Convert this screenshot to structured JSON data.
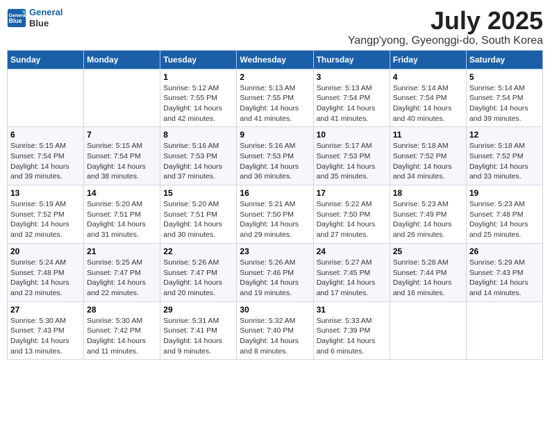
{
  "logo": {
    "line1": "General",
    "line2": "Blue"
  },
  "title": "July 2025",
  "subtitle": "Yangp'yong, Gyeonggi-do, South Korea",
  "headers": [
    "Sunday",
    "Monday",
    "Tuesday",
    "Wednesday",
    "Thursday",
    "Friday",
    "Saturday"
  ],
  "weeks": [
    [
      {
        "day": "",
        "info": ""
      },
      {
        "day": "",
        "info": ""
      },
      {
        "day": "1",
        "info": "Sunrise: 5:12 AM\nSunset: 7:55 PM\nDaylight: 14 hours and 42 minutes."
      },
      {
        "day": "2",
        "info": "Sunrise: 5:13 AM\nSunset: 7:55 PM\nDaylight: 14 hours and 41 minutes."
      },
      {
        "day": "3",
        "info": "Sunrise: 5:13 AM\nSunset: 7:54 PM\nDaylight: 14 hours and 41 minutes."
      },
      {
        "day": "4",
        "info": "Sunrise: 5:14 AM\nSunset: 7:54 PM\nDaylight: 14 hours and 40 minutes."
      },
      {
        "day": "5",
        "info": "Sunrise: 5:14 AM\nSunset: 7:54 PM\nDaylight: 14 hours and 39 minutes."
      }
    ],
    [
      {
        "day": "6",
        "info": "Sunrise: 5:15 AM\nSunset: 7:54 PM\nDaylight: 14 hours and 39 minutes."
      },
      {
        "day": "7",
        "info": "Sunrise: 5:15 AM\nSunset: 7:54 PM\nDaylight: 14 hours and 38 minutes."
      },
      {
        "day": "8",
        "info": "Sunrise: 5:16 AM\nSunset: 7:53 PM\nDaylight: 14 hours and 37 minutes."
      },
      {
        "day": "9",
        "info": "Sunrise: 5:16 AM\nSunset: 7:53 PM\nDaylight: 14 hours and 36 minutes."
      },
      {
        "day": "10",
        "info": "Sunrise: 5:17 AM\nSunset: 7:53 PM\nDaylight: 14 hours and 35 minutes."
      },
      {
        "day": "11",
        "info": "Sunrise: 5:18 AM\nSunset: 7:52 PM\nDaylight: 14 hours and 34 minutes."
      },
      {
        "day": "12",
        "info": "Sunrise: 5:18 AM\nSunset: 7:52 PM\nDaylight: 14 hours and 33 minutes."
      }
    ],
    [
      {
        "day": "13",
        "info": "Sunrise: 5:19 AM\nSunset: 7:52 PM\nDaylight: 14 hours and 32 minutes."
      },
      {
        "day": "14",
        "info": "Sunrise: 5:20 AM\nSunset: 7:51 PM\nDaylight: 14 hours and 31 minutes."
      },
      {
        "day": "15",
        "info": "Sunrise: 5:20 AM\nSunset: 7:51 PM\nDaylight: 14 hours and 30 minutes."
      },
      {
        "day": "16",
        "info": "Sunrise: 5:21 AM\nSunset: 7:50 PM\nDaylight: 14 hours and 29 minutes."
      },
      {
        "day": "17",
        "info": "Sunrise: 5:22 AM\nSunset: 7:50 PM\nDaylight: 14 hours and 27 minutes."
      },
      {
        "day": "18",
        "info": "Sunrise: 5:23 AM\nSunset: 7:49 PM\nDaylight: 14 hours and 26 minutes."
      },
      {
        "day": "19",
        "info": "Sunrise: 5:23 AM\nSunset: 7:48 PM\nDaylight: 14 hours and 25 minutes."
      }
    ],
    [
      {
        "day": "20",
        "info": "Sunrise: 5:24 AM\nSunset: 7:48 PM\nDaylight: 14 hours and 23 minutes."
      },
      {
        "day": "21",
        "info": "Sunrise: 5:25 AM\nSunset: 7:47 PM\nDaylight: 14 hours and 22 minutes."
      },
      {
        "day": "22",
        "info": "Sunrise: 5:26 AM\nSunset: 7:47 PM\nDaylight: 14 hours and 20 minutes."
      },
      {
        "day": "23",
        "info": "Sunrise: 5:26 AM\nSunset: 7:46 PM\nDaylight: 14 hours and 19 minutes."
      },
      {
        "day": "24",
        "info": "Sunrise: 5:27 AM\nSunset: 7:45 PM\nDaylight: 14 hours and 17 minutes."
      },
      {
        "day": "25",
        "info": "Sunrise: 5:28 AM\nSunset: 7:44 PM\nDaylight: 14 hours and 16 minutes."
      },
      {
        "day": "26",
        "info": "Sunrise: 5:29 AM\nSunset: 7:43 PM\nDaylight: 14 hours and 14 minutes."
      }
    ],
    [
      {
        "day": "27",
        "info": "Sunrise: 5:30 AM\nSunset: 7:43 PM\nDaylight: 14 hours and 13 minutes."
      },
      {
        "day": "28",
        "info": "Sunrise: 5:30 AM\nSunset: 7:42 PM\nDaylight: 14 hours and 11 minutes."
      },
      {
        "day": "29",
        "info": "Sunrise: 5:31 AM\nSunset: 7:41 PM\nDaylight: 14 hours and 9 minutes."
      },
      {
        "day": "30",
        "info": "Sunrise: 5:32 AM\nSunset: 7:40 PM\nDaylight: 14 hours and 8 minutes."
      },
      {
        "day": "31",
        "info": "Sunrise: 5:33 AM\nSunset: 7:39 PM\nDaylight: 14 hours and 6 minutes."
      },
      {
        "day": "",
        "info": ""
      },
      {
        "day": "",
        "info": ""
      }
    ]
  ]
}
